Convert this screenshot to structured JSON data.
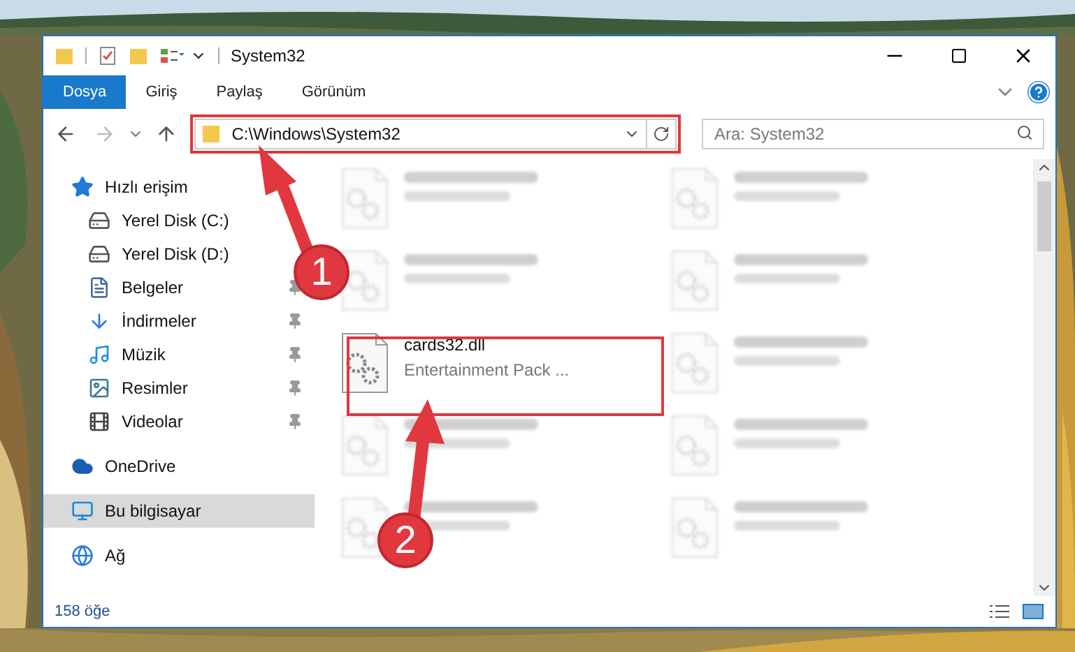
{
  "window": {
    "title": "System32"
  },
  "ribbon_tabs": [
    {
      "label": "Dosya",
      "selected": true
    },
    {
      "label": "Giriş",
      "selected": false
    },
    {
      "label": "Paylaş",
      "selected": false
    },
    {
      "label": "Görünüm",
      "selected": false
    }
  ],
  "address_bar": {
    "path": "C:\\Windows\\System32"
  },
  "search": {
    "placeholder": "Ara: System32"
  },
  "sidebar": {
    "items": [
      {
        "label": "Hızlı erişim",
        "kind": "quick",
        "selected": false,
        "children": [
          {
            "label": "Yerel Disk (C:)",
            "kind": "disk-c",
            "pinned": false,
            "selected": false
          },
          {
            "label": "Yerel Disk (D:)",
            "kind": "disk",
            "pinned": false,
            "selected": false
          },
          {
            "label": "Belgeler",
            "kind": "docs",
            "pinned": true,
            "selected": false
          },
          {
            "label": "İndirmeler",
            "kind": "download",
            "pinned": true,
            "selected": false
          },
          {
            "label": "Müzik",
            "kind": "music",
            "pinned": true,
            "selected": false
          },
          {
            "label": "Resimler",
            "kind": "pictures",
            "pinned": true,
            "selected": false
          },
          {
            "label": "Videolar",
            "kind": "videos",
            "pinned": true,
            "selected": false
          }
        ]
      },
      {
        "label": "OneDrive",
        "kind": "cloud",
        "selected": false
      },
      {
        "label": "Bu bilgisayar",
        "kind": "pc",
        "selected": true
      },
      {
        "label": "Ağ",
        "kind": "network",
        "selected": false
      }
    ]
  },
  "files": [
    {
      "blurred": true
    },
    {
      "blurred": true
    },
    {
      "blurred": true
    },
    {
      "blurred": true
    },
    {
      "name": "cards32.dll",
      "type": "Entertainment Pack ...",
      "blurred": false
    },
    {
      "blurred": true
    },
    {
      "blurred": true
    },
    {
      "blurred": true
    },
    {
      "blurred": true
    },
    {
      "blurred": true
    }
  ],
  "status_bar": {
    "count": "158 öğe"
  },
  "annotations": [
    {
      "number": "1"
    },
    {
      "number": "2"
    }
  ]
}
